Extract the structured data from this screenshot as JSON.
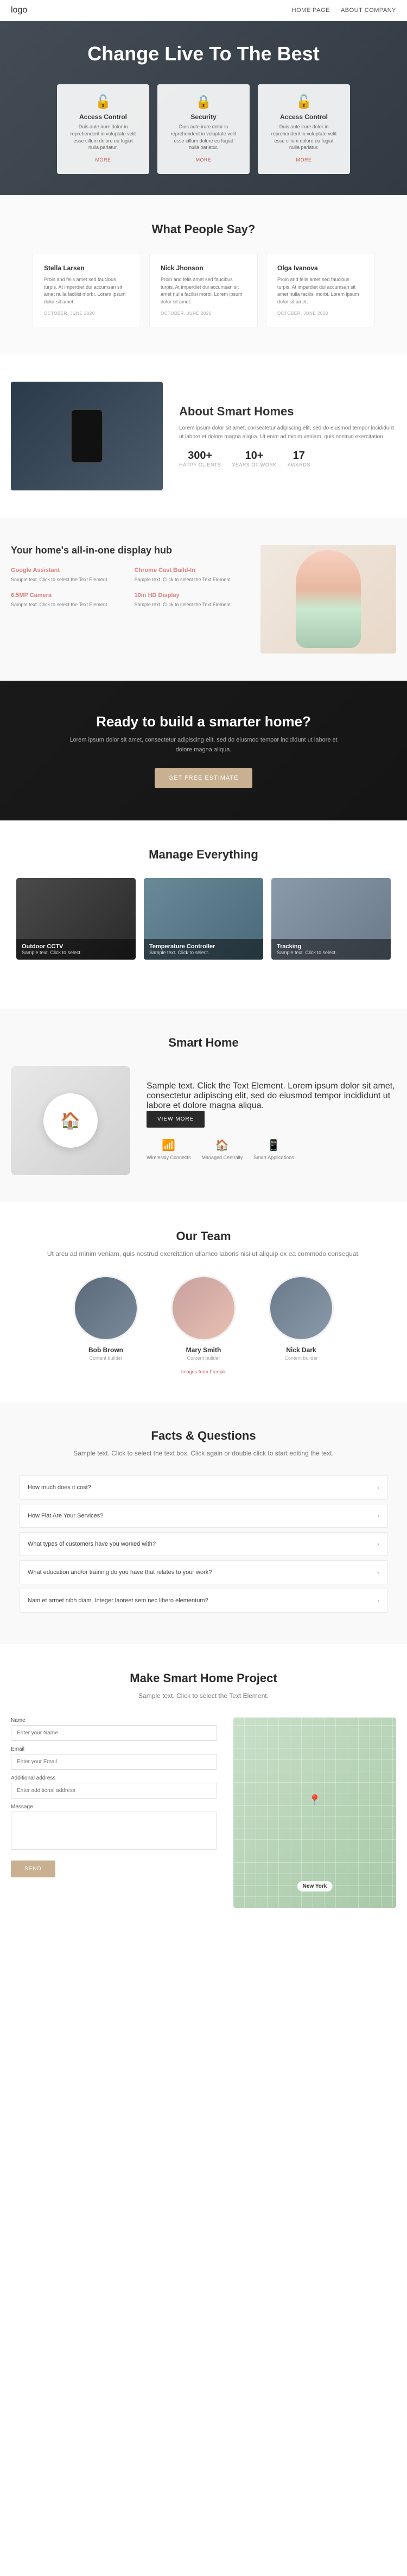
{
  "nav": {
    "logo": "logo",
    "links": [
      {
        "label": "HOME PAGE",
        "href": "#"
      },
      {
        "label": "ABOUT COMPANY",
        "href": "#"
      }
    ]
  },
  "hero": {
    "title": "Change Live To The Best",
    "cards": [
      {
        "id": "access-control-1",
        "icon": "🔓",
        "title": "Access Control",
        "description": "Duis aute irure dolor in reprehenderit in voluptate velit esse cillum dolore eu fugiat nulla pariatur.",
        "more_label": "MORE"
      },
      {
        "id": "security",
        "icon": "🔒",
        "title": "Security",
        "description": "Duis aute irure dolor in reprehenderit in voluptate velit esse cillum dolore eu fugiat nulla pariatur.",
        "more_label": "MORE"
      },
      {
        "id": "access-control-2",
        "icon": "🔓",
        "title": "Access Control",
        "description": "Duis aute irure dolor in reprehenderit in voluptate velit esse cillum dolore eu fugiat nulla pariatur.",
        "more_label": "MORE"
      }
    ]
  },
  "testimonials": {
    "section_title": "What People Say?",
    "items": [
      {
        "name": "Stella Larsen",
        "text": "Proin and felis amet sed faucibus turpis. At imperdiet dui accumsan sit amet nulla facilisi morbi. Lorem ipsum dolor sit amet.",
        "date": "OCTOBER, JUNE 2020"
      },
      {
        "name": "Nick Jhonson",
        "text": "Proin and felis amet sed faucibus turpis. At imperdiet dui accumsan sit amet nulla facilisi morbi. Lorem ipsum dolor sit amet.",
        "date": "OCTOBER, JUNE 2020"
      },
      {
        "name": "Olga Ivanova",
        "text": "Proin and felis amet sed faucibus turpis. At imperdiet dui accumsan sit amet nulla facilisi morbi. Lorem ipsum dolor sit amet.",
        "date": "OCTOBER, JUNE 2020"
      }
    ]
  },
  "about_smart": {
    "section_title": "About Smart Homes",
    "description": "Lorem ipsum dolor sit amet, consectetur adipiscing elit, sed do eiusmod tempor incididunt ut labore et dolore magna aliqua. Ut enim ad minim veniam, quis nostrud exercitation.",
    "stats": [
      {
        "number": "300+",
        "label": "HAPPY CLIENTS"
      },
      {
        "number": "10+",
        "label": "YEARS OF WORK"
      },
      {
        "number": "17",
        "label": "AWARDS"
      }
    ]
  },
  "display_hub": {
    "section_title": "Your home's all-in-one display hub",
    "features": [
      {
        "title": "Google Assistant",
        "description": "Sample text. Click to select the Text Element."
      },
      {
        "title": "Chrome Cast Build-In",
        "description": "Sample text. Click to select the Text Element."
      },
      {
        "title": "6.5MP Camera",
        "description": "Sample text. Click to select the Text Element."
      },
      {
        "title": "10in HD Display",
        "description": "Sample text. Click to select the Text Element."
      }
    ]
  },
  "cta": {
    "title": "Ready to build a smarter home?",
    "description": "Lorem ipsum dolor sit amet, consectetur adipiscing elit, sed do eiusmod tempor incididunt ut labore et dolore magna aliqua.",
    "button_label": "GET FREE ESTIMATE"
  },
  "manage": {
    "section_title": "Manage Everything",
    "cards": [
      {
        "title": "Outdoor CCTV",
        "description": "Sample text. Click to select."
      },
      {
        "title": "Temperature Controller",
        "description": "Sample text. Click to select."
      },
      {
        "title": "Tracking",
        "description": "Sample text. Click to select."
      }
    ]
  },
  "smart_home": {
    "section_title": "Smart Home",
    "description": "Sample text. Click the Text Element. Lorem ipsum dolor sit amet, consectetur adipiscing elit, sed do eiusmod tempor incididunt ut labore et dolore magna aliqua.",
    "button_label": "VIEW MORE",
    "icons": [
      {
        "icon": "📶",
        "label": "Wirelessly Connects"
      },
      {
        "icon": "🏠",
        "label": "Managed Centrally"
      },
      {
        "icon": "📱",
        "label": "Smart Applications"
      }
    ]
  },
  "team": {
    "section_title": "Our Team",
    "description": "Ut arcu ad minim veniam, quis nostrud exercitation ullamco laboris nisi ut aliquip ex ea commodo consequat.",
    "members": [
      {
        "name": "Bob Brown",
        "role": "Content builder",
        "avatar_class": "avatar-bob"
      },
      {
        "name": "Mary Smith",
        "role": "Content builder",
        "avatar_class": "avatar-mary"
      },
      {
        "name": "Nick Dark",
        "role": "Content builder",
        "avatar_class": "avatar-nick"
      }
    ],
    "images_from": "Images from Freepik"
  },
  "faq": {
    "section_title": "Facts & Questions",
    "description": "Sample text. Click to select the text box. Click again or double click to start editing the text.",
    "items": [
      {
        "question": "How much does it cost?"
      },
      {
        "question": "How Flat Are Your Services?"
      },
      {
        "question": "What types of customers have you worked with?"
      },
      {
        "question": "What education and/or training do you have that relates to your work?"
      },
      {
        "question": "Nam et armet nibh diam. Integer laoreet sem nec libero elementum?"
      }
    ]
  },
  "contact": {
    "section_title": "Make Smart Home Project",
    "description": "Sample text. Click to select the Text Element.",
    "form": {
      "name_label": "Name",
      "name_placeholder": "Enter your Name",
      "email_label": "Email",
      "email_placeholder": "Enter your Email",
      "address_label": "Additional address",
      "address_placeholder": "Enter additional address",
      "message_label": "Message",
      "message_placeholder": "",
      "submit_label": "SEND"
    },
    "map_label": "New York"
  }
}
